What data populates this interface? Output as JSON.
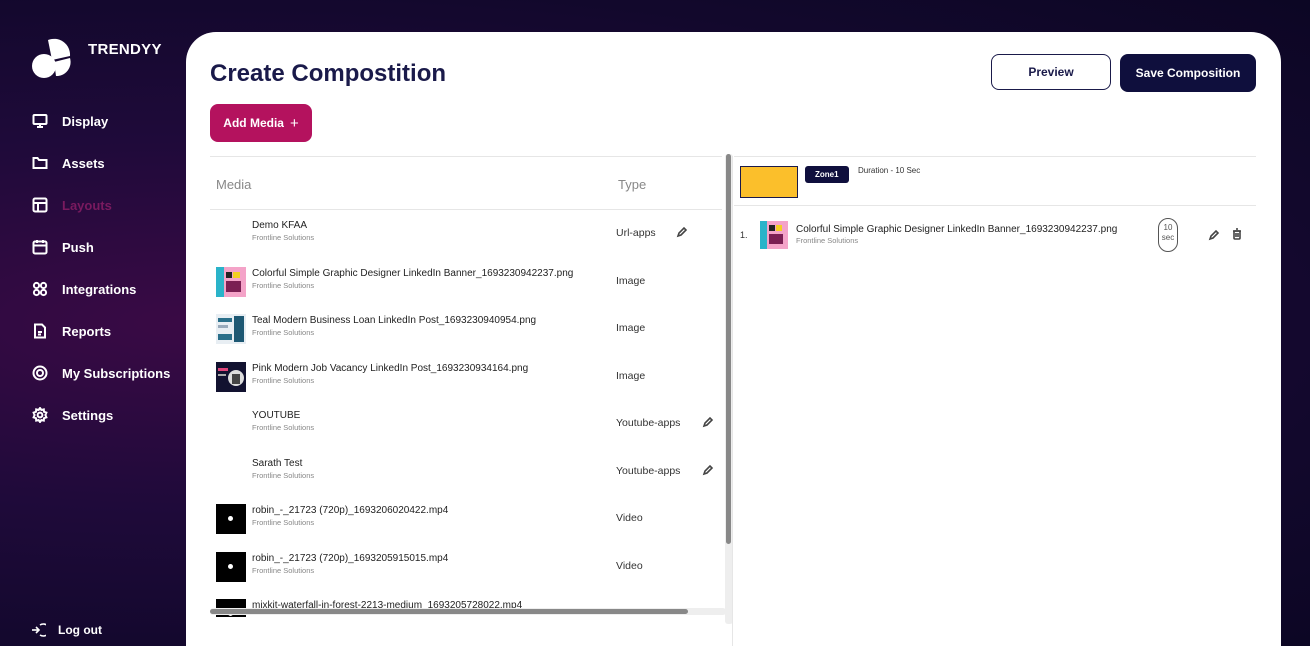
{
  "brand": {
    "name": "TRENDYY"
  },
  "nav": [
    {
      "id": "display",
      "label": "Display",
      "icon": "monitor-icon"
    },
    {
      "id": "assets",
      "label": "Assets",
      "icon": "folder-icon"
    },
    {
      "id": "layouts",
      "label": "Layouts",
      "icon": "layout-icon",
      "active": true
    },
    {
      "id": "push",
      "label": "Push",
      "icon": "calendar-icon"
    },
    {
      "id": "integrations",
      "label": "Integrations",
      "icon": "grid-icon"
    },
    {
      "id": "reports",
      "label": "Reports",
      "icon": "file-icon"
    },
    {
      "id": "subscriptions",
      "label": "My Subscriptions",
      "icon": "target-icon"
    },
    {
      "id": "settings",
      "label": "Settings",
      "icon": "gear-icon"
    }
  ],
  "logout": {
    "label": "Log out"
  },
  "page": {
    "title": "Create Compostition"
  },
  "actions": {
    "preview": "Preview",
    "save": "Save Composition",
    "add_media": "Add Media",
    "add_media_icon": "+"
  },
  "media_table": {
    "headers": {
      "media": "Media",
      "type": "Type"
    },
    "rows": [
      {
        "name": "Demo KFAA",
        "sub": "Frontline Solutions",
        "type": "Url-apps",
        "thumb": "none",
        "editable": true
      },
      {
        "name": "Colorful Simple Graphic Designer LinkedIn Banner_1693230942237.png",
        "sub": "Frontline Solutions",
        "type": "Image",
        "thumb": "banner",
        "editable": false
      },
      {
        "name": "Teal Modern Business Loan LinkedIn Post_1693230940954.png",
        "sub": "Frontline Solutions",
        "type": "Image",
        "thumb": "teal",
        "editable": false
      },
      {
        "name": "Pink Modern Job Vacancy LinkedIn Post_1693230934164.png",
        "sub": "Frontline Solutions",
        "type": "Image",
        "thumb": "pink",
        "editable": false
      },
      {
        "name": "YOUTUBE",
        "sub": "Frontline Solutions",
        "type": "Youtube-apps",
        "thumb": "none",
        "editable": true
      },
      {
        "name": "Sarath Test",
        "sub": "Frontline Solutions",
        "type": "Youtube-apps",
        "thumb": "none",
        "editable": true
      },
      {
        "name": "robin_-_21723 (720p)_1693206020422.mp4",
        "sub": "Frontline Solutions",
        "type": "Video",
        "thumb": "video",
        "editable": false
      },
      {
        "name": "robin_-_21723 (720p)_1693205915015.mp4",
        "sub": "Frontline Solutions",
        "type": "Video",
        "thumb": "video",
        "editable": false
      },
      {
        "name": "mixkit-waterfall-in-forest-2213-medium_1693205728022.mp4",
        "sub": "",
        "type": "",
        "thumb": "video",
        "editable": false
      }
    ]
  },
  "zone": {
    "swatch_color": "#fbbf2b",
    "tag": "Zone1",
    "duration": "Duration - 10 Sec",
    "items": [
      {
        "index": "1.",
        "name": "Colorful Simple Graphic Designer LinkedIn Banner_1693230942237.png",
        "sub": "Frontline Solutions",
        "duration": "10 sec"
      }
    ]
  },
  "colors": {
    "primary": "#0f0f3d",
    "accent": "#b4125e",
    "zone": "#fbbf2b"
  }
}
